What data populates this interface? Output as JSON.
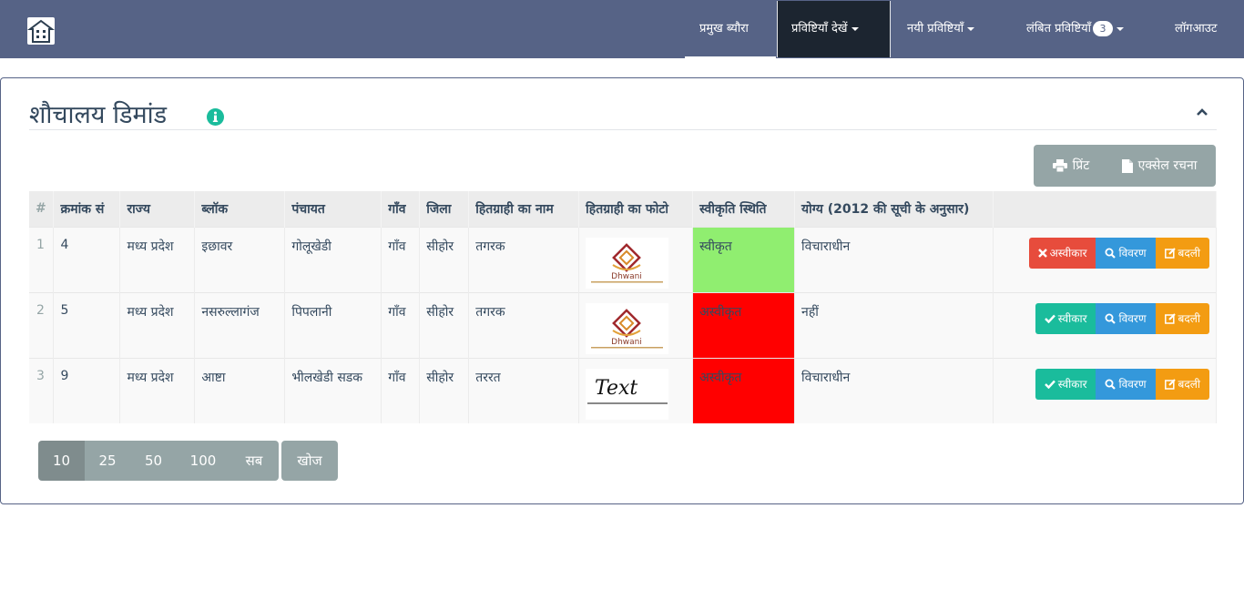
{
  "nav": {
    "items": [
      {
        "label": "प्रमुख ब्यौरा"
      },
      {
        "label": "प्रविष्टियाँ देखें"
      },
      {
        "label": "नयी प्रविष्टियाँ"
      },
      {
        "label": "लंबित प्रविष्टियाँ",
        "badge": "3"
      },
      {
        "label": "लॉगआउट"
      }
    ]
  },
  "panel": {
    "title": "शौचालय डिमांड",
    "print_label": "प्रिंट",
    "excel_label": "एक्सेल रचना"
  },
  "table": {
    "headers": [
      "#",
      "क्रमांक सं",
      "राज्य",
      "ब्लॉक",
      "पंचायत",
      "गाँव",
      "जिला",
      "हितग्राही का नाम",
      "हितग्राही का फोटो",
      "स्वीकृति स्थिति",
      "योग्य (2012 की सूची के अनुसार)"
    ],
    "rows": [
      {
        "idx": "1",
        "serial": "4",
        "state": "मध्य प्रदेश",
        "block": "इछावर",
        "panchayat": "गोलूखेडी",
        "village": "गाँव",
        "district": "सीहोर",
        "name": "तगरक",
        "photo": "Dhwani",
        "status": "स्वीकृत",
        "eligible": "विचाराधीन",
        "toggle_label": "अस्वीकार",
        "detail_label": "विवरण",
        "edit_label": "बदली"
      },
      {
        "idx": "2",
        "serial": "5",
        "state": "मध्य प्रदेश",
        "block": "नसरुल्लागंज",
        "panchayat": "पिपलानी",
        "village": "गाँव",
        "district": "सीहोर",
        "name": "तगरक",
        "photo": "Dhwani",
        "status": "अस्वीकृत",
        "eligible": "नहीं",
        "toggle_label": "स्वीकार",
        "detail_label": "विवरण",
        "edit_label": "बदली"
      },
      {
        "idx": "3",
        "serial": "9",
        "state": "मध्य प्रदेश",
        "block": "आष्टा",
        "panchayat": "भीलखेडी सडक",
        "village": "गाँव",
        "district": "सीहोर",
        "name": "तररत",
        "photo": "Text",
        "status": "अस्वीकृत",
        "eligible": "विचाराधीन",
        "toggle_label": "स्वीकार",
        "detail_label": "विवरण",
        "edit_label": "बदली"
      }
    ]
  },
  "pagination": {
    "sizes": [
      "10",
      "25",
      "50",
      "100",
      "सब"
    ],
    "active": "10",
    "search_label": "खोज"
  },
  "colors": {
    "navbar": "#566386",
    "accepted": "#90ee70",
    "rejected": "#ff0000"
  }
}
